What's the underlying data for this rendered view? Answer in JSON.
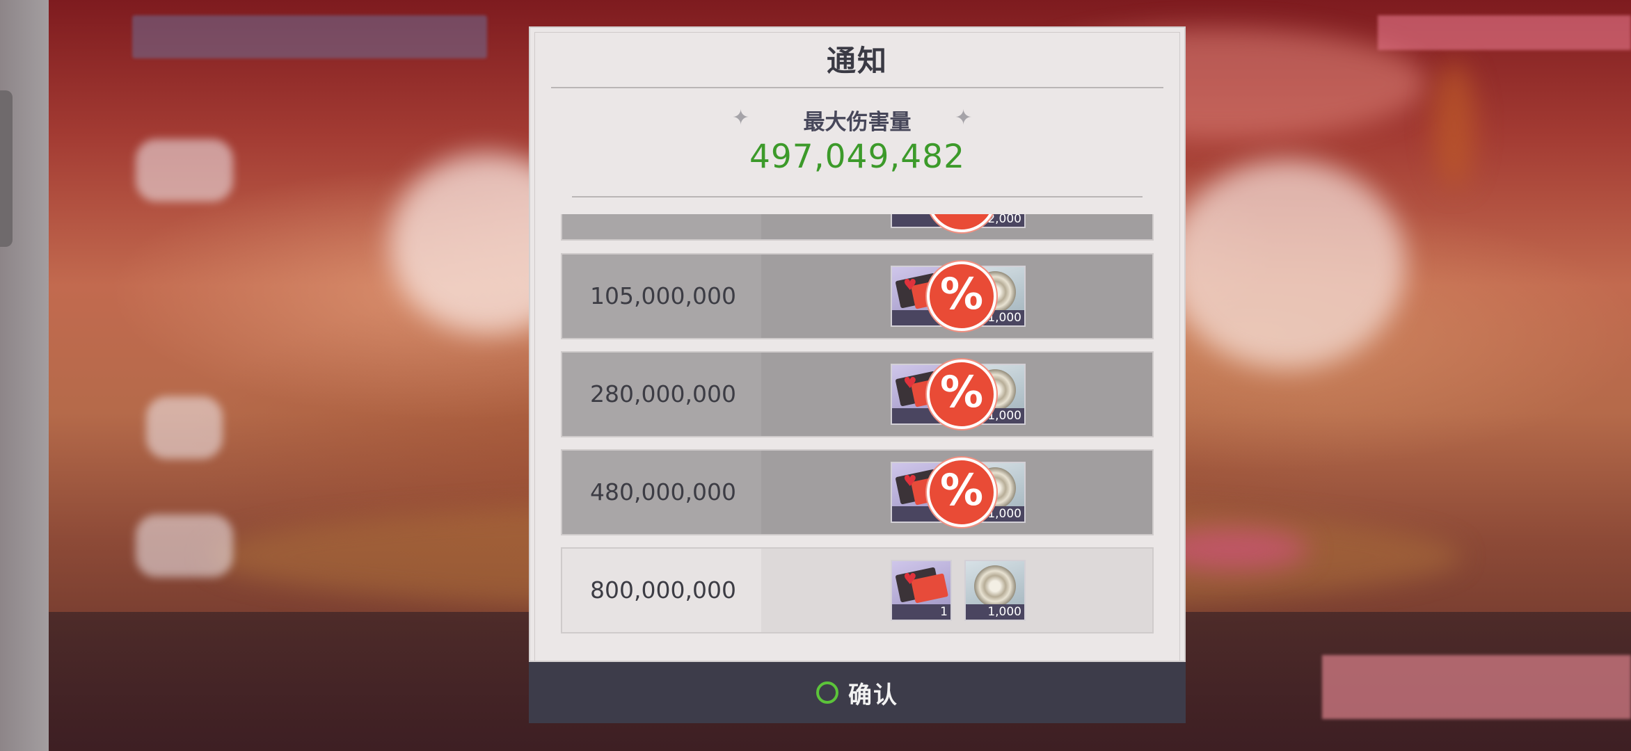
{
  "dialog": {
    "title": "通知",
    "stat_label": "最大伤害量",
    "stat_value": "497,049,482",
    "confirm_label": "确认"
  },
  "rewards": [
    {
      "threshold": "",
      "ticket_count": "",
      "coin_count": "2,000",
      "claimed": true
    },
    {
      "threshold": "105,000,000",
      "ticket_count": "",
      "coin_count": "1,000",
      "claimed": true
    },
    {
      "threshold": "280,000,000",
      "ticket_count": "",
      "coin_count": "1,000",
      "claimed": true
    },
    {
      "threshold": "480,000,000",
      "ticket_count": "",
      "coin_count": "1,000",
      "claimed": true
    },
    {
      "threshold": "800,000,000",
      "ticket_count": "1",
      "coin_count": "1,000",
      "claimed": false
    }
  ],
  "icons": {
    "claimed_stamp": "claimed-stamp-icon",
    "ticket": "ticket-icon",
    "coin": "gear-coin-icon",
    "sparkle": "sparkle-icon",
    "confirm": "circle-icon"
  },
  "colors": {
    "stat_value": "#3c9a2a",
    "claimed_stamp": "#e94b36",
    "confirm_bar": "#3d3c4a",
    "confirm_ring": "#5cc43a"
  }
}
